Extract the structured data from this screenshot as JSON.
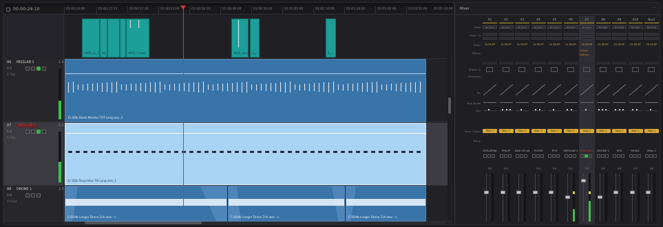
{
  "timeline": {
    "timecode": "00:00:24:10",
    "ruler": [
      "01:00:14:00",
      "01:00:15:15",
      "01:00:17:20",
      "01:00:23:00",
      "01:00:24:10",
      "01:00:40:00",
      "01:00:50:00",
      "01:01:02:00",
      "01:01:10:00",
      "01:01:20:20",
      "01:03:40:00",
      "01:03:51:00",
      "01:05:10:00"
    ],
    "video_clips": [
      {
        "name": "A003_as_1"
      },
      {
        "name": "A0...1"
      },
      {
        "name": "A003_7.mov"
      },
      {
        "name": "A000_mov"
      },
      {
        "name": "A_c"
      },
      {
        "name": "A_c"
      }
    ],
    "audio_tracks": [
      {
        "id": "A6",
        "name": "MISSLAB 1",
        "num": "1.0",
        "volume": "0.0",
        "clips": "1 Clip",
        "clip_name": "11.0Db  Heart Monitor.TOT.Long.wav_1"
      },
      {
        "id": "A7",
        "name": "MISSLAB 2",
        "num": "1.0",
        "volume": "0.0",
        "clips": "1 Clip",
        "clip_name": "11.0Db  Respiratur Fill.Long.wav_1"
      },
      {
        "id": "A8",
        "name": "DRONE 1",
        "num": "2.0",
        "volume": "0.0",
        "clips": "3 Clips",
        "clip_names": [
          "C-SOdb   Longer Drone 2ch.wav - L",
          "C-SOdb   Longer Drone 2ch.wav - L",
          "C-SOdb   Longer Drone 2ch.wav - L"
        ]
      }
    ]
  },
  "mixer": {
    "title": "Mixer",
    "menu_icon": "more-dots-icon",
    "row_labels": [
      "Input",
      "Track FX",
      "Order",
      "Effects",
      "Effects In",
      "Dynamics",
      "EQ",
      "Bus Sends",
      "Pan",
      "Main Output",
      "Group"
    ],
    "columns": [
      {
        "hd": "A1",
        "input": "No Input",
        "order": "FX DS EP",
        "bus": "Main 1",
        "name": "EVELAYNA",
        "db": "0.0"
      },
      {
        "hd": "A2",
        "input": "No Input",
        "order": "FX DS EP",
        "bus": "Main 1",
        "name": "PHILIP",
        "db": "0.0"
      },
      {
        "hd": "A3",
        "input": "No Input",
        "order": "FX DS EP",
        "bus": "Main 1",
        "name": "ADA VO alt"
      },
      {
        "hd": "A4",
        "input": "No Input",
        "order": "FX DS EP",
        "bus": "Main 1",
        "name": "ROOM",
        "db": "0.0"
      },
      {
        "hd": "A5",
        "input": "No Input",
        "order": "FX DS EP",
        "bus": "Main 1",
        "name": "PFX",
        "db": "0.0"
      },
      {
        "hd": "A6",
        "input": "No Input",
        "order": "FX DS EP",
        "bus": "Main 1",
        "name": "MISSLAB 1",
        "db": "0.0"
      },
      {
        "hd": "A7",
        "input": "No Input",
        "order": "FX DS EP",
        "bus": "Main 1",
        "name": "MISSLAB 2",
        "db": "0.0",
        "selected": true
      },
      {
        "hd": "A8",
        "input": "No Input",
        "order": "FX DS EP",
        "bus": "Main 1",
        "name": "DRONE 1",
        "db": "0.0"
      },
      {
        "hd": "A9",
        "input": "No Input",
        "order": "FX DS EP",
        "bus": "Main 1",
        "name": "SFX",
        "db": "0.0"
      },
      {
        "hd": "A10",
        "input": "No Input",
        "order": "FX DS EP",
        "bus": "Main 1",
        "name": "MUSIC",
        "db": "0.0"
      },
      {
        "hd": "Bus1",
        "input": "No Input",
        "order": "FX DS EP",
        "bus": "Main 1",
        "name": "Main 1",
        "db": "0.0"
      }
    ],
    "effect_a7": "Flanger",
    "effect_a7b": "DeEsser"
  },
  "colors": {
    "video_clip": "#1d9e98",
    "audio_clip": "#3974a8",
    "audio_clip_selected": "#a9d3f2",
    "playhead": "#d23a35",
    "bus_button": "#d9a934",
    "meter": "#3cc24a"
  }
}
